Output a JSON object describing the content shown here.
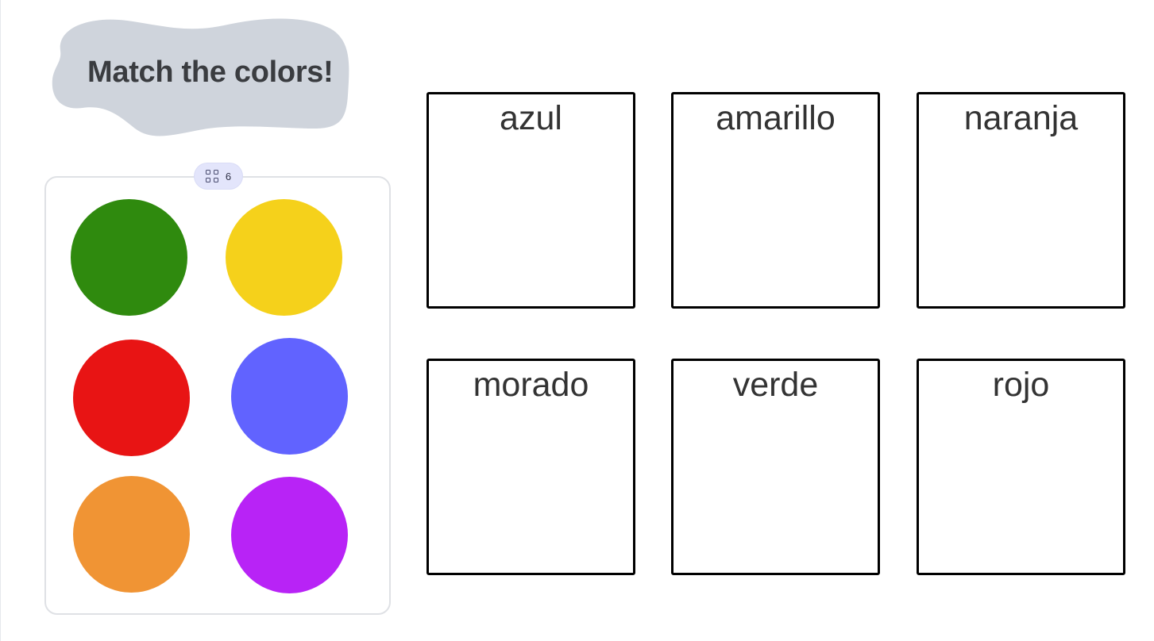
{
  "title": "Match the colors!",
  "tray": {
    "count": "6",
    "count_icon": "grid-icon",
    "items": [
      {
        "name": "green",
        "color": "#2f8a0e"
      },
      {
        "name": "yellow",
        "color": "#f5d11b"
      },
      {
        "name": "red",
        "color": "#e81414"
      },
      {
        "name": "blue",
        "color": "#6163ff"
      },
      {
        "name": "orange",
        "color": "#f09434"
      },
      {
        "name": "purple",
        "color": "#b823f6"
      }
    ]
  },
  "targets": [
    {
      "label": "azul"
    },
    {
      "label": "amarillo"
    },
    {
      "label": "naranja"
    },
    {
      "label": "morado"
    },
    {
      "label": "verde"
    },
    {
      "label": "rojo"
    }
  ],
  "colors": {
    "title_blob": "#cfd4dc",
    "box_border": "#000000",
    "tray_border": "#dfe1e5",
    "badge_bg": "#e3e5fb"
  }
}
